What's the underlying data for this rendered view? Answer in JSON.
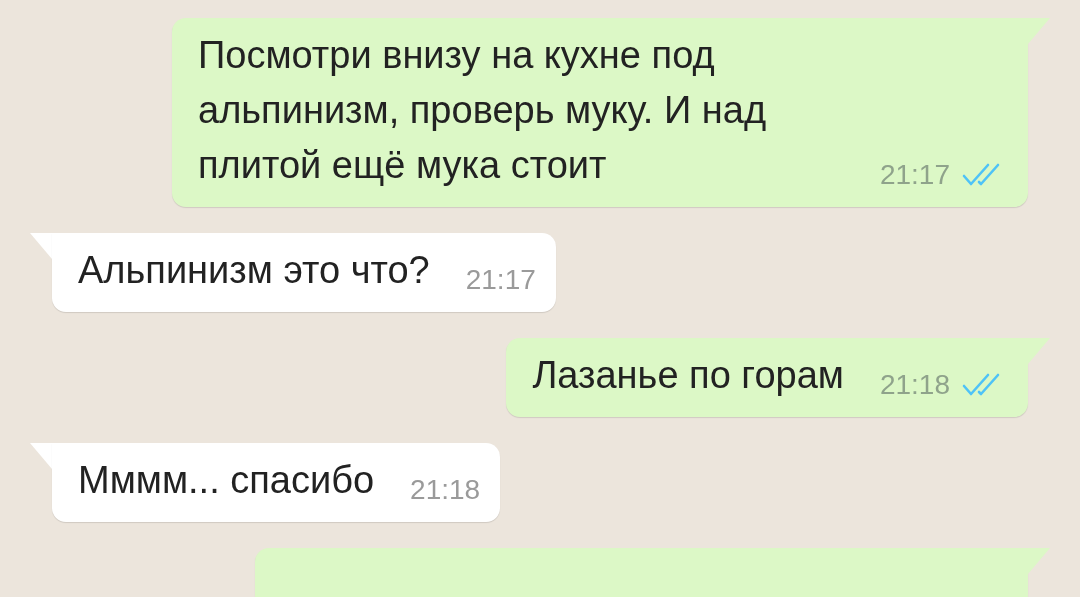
{
  "messages": [
    {
      "kind": "outgoing",
      "cut": false,
      "text": "Посмотри внизу на кухне под альпинизм, проверь муку. И над плитой ещё мука стоит",
      "time": "21:17",
      "read": true
    },
    {
      "kind": "incoming",
      "cut": false,
      "text": "Альпинизм это что?",
      "time": "21:17"
    },
    {
      "kind": "outgoing",
      "cut": false,
      "text": "Лазанье по горам",
      "time": "21:18",
      "read": true
    },
    {
      "kind": "incoming",
      "cut": false,
      "text": "Мммм... спасибо",
      "time": "21:18"
    },
    {
      "kind": "outgoing",
      "cut": true
    }
  ]
}
